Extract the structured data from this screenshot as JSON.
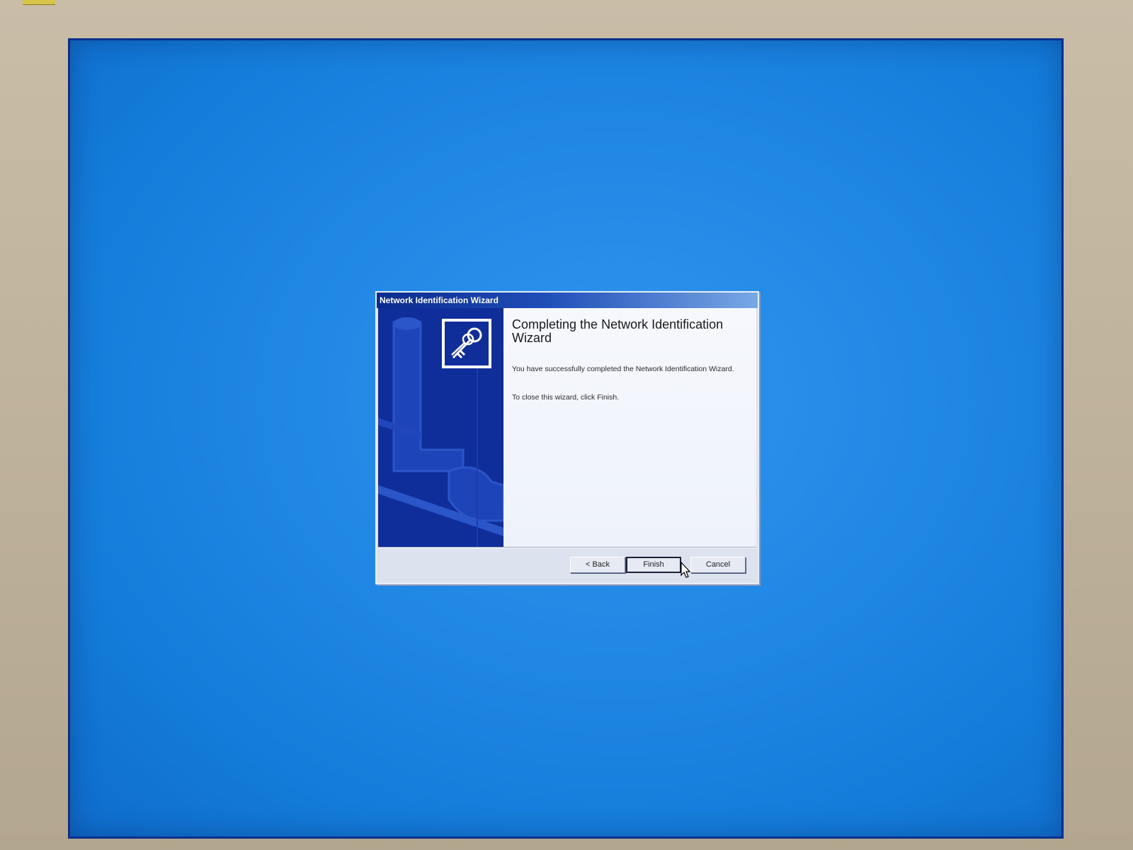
{
  "dialog": {
    "title": "Network Identification Wizard",
    "heading": "Completing the Network Identification Wizard",
    "message_success": "You have successfully completed the Network Identification Wizard.",
    "message_close": "To close this wizard, click Finish.",
    "icon": "keys-icon"
  },
  "buttons": {
    "back_label": "< Back",
    "finish_label": "Finish",
    "cancel_label": "Cancel"
  },
  "colors": {
    "desktop": "#1f86e4",
    "side_panel": "#0f2e9a",
    "titlebar_start": "#0b2a8e",
    "titlebar_end": "#79a8e6"
  }
}
